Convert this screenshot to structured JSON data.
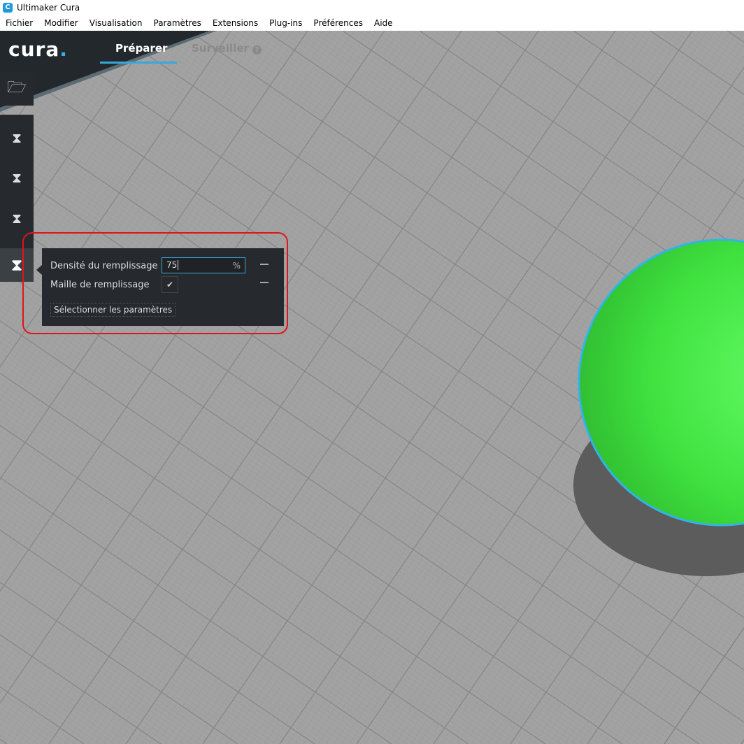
{
  "window": {
    "title": "Ultimaker Cura"
  },
  "menu": [
    "Fichier",
    "Modifier",
    "Visualisation",
    "Paramètres",
    "Extensions",
    "Plug-ins",
    "Préférences",
    "Aide"
  ],
  "header": {
    "brand": "cura",
    "tabs": [
      {
        "label": "Préparer",
        "active": true
      },
      {
        "label": "Surveiller",
        "active": false
      }
    ]
  },
  "toolbar": [
    "open-file-icon",
    "move-tool-icon",
    "scale-tool-icon",
    "rotate-tool-icon",
    "mirror-tool-icon",
    "per-model-settings-icon"
  ],
  "panel": {
    "density_label": "Densité du remplissage",
    "density_value": "75",
    "density_unit": "%",
    "mesh_label": "Maille de remplissage",
    "mesh_checked": true,
    "select_button": "Sélectionner les paramètres"
  },
  "colors": {
    "accent": "#3aa7db",
    "model": "#3fe63f",
    "highlight": "#e0141b"
  }
}
